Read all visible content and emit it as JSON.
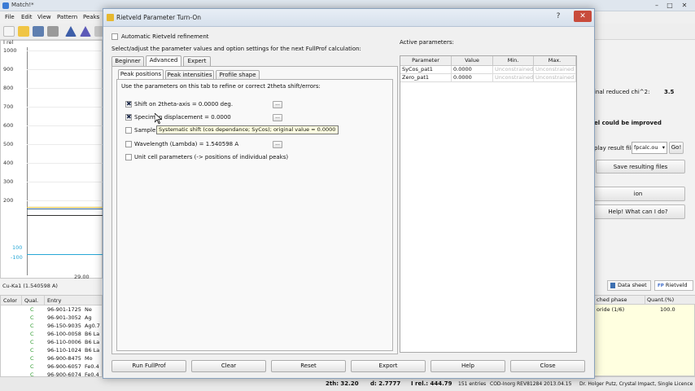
{
  "app": {
    "title": "Match!*",
    "menu": [
      "File",
      "Edit",
      "View",
      "Pattern",
      "Peaks"
    ],
    "plot": {
      "y_axis_label": "I rel",
      "y_ticks": [
        "1000",
        "900",
        "800",
        "700",
        "600",
        "500",
        "400",
        "300",
        "200"
      ],
      "x_tick": "29.00",
      "marker_label_1": "100",
      "marker_label_2": "-100"
    },
    "wavelength_status": "Cu-Ka1 (1.540598 A)",
    "phase_table": {
      "headers": [
        "Color",
        "Qual.",
        "Entry"
      ],
      "rows": [
        {
          "qual": "C",
          "entry": "96-901-1725",
          "name": "Ne"
        },
        {
          "qual": "C",
          "entry": "96-901-3052",
          "name": "Ag"
        },
        {
          "qual": "C",
          "entry": "96-150-9035",
          "name": "Ag0.7"
        },
        {
          "qual": "C",
          "entry": "96-100-0058",
          "name": "B6 La"
        },
        {
          "qual": "C",
          "entry": "96-110-0006",
          "name": "B6 La"
        },
        {
          "qual": "C",
          "entry": "96-110-1024",
          "name": "B6 La"
        },
        {
          "qual": "C",
          "entry": "96-900-8475",
          "name": "Mo"
        },
        {
          "qual": "C",
          "entry": "96-900-6057",
          "name": "Fe0.4"
        },
        {
          "qual": "C",
          "entry": "96-900-6074",
          "name": "Fe0.4"
        }
      ]
    },
    "right_panel": {
      "chi_label": "inal reduced chi^2:",
      "chi_value": "3.5",
      "could_improve": "el could be improved",
      "display_label": "play result file",
      "file_select": "fpcalc.ou",
      "go_button": "Go!",
      "save_button": "Save resulting files",
      "option_button": "ion",
      "help_button": "Help! What can I do?",
      "tabs": [
        "Data sheet",
        "Rietveld"
      ],
      "tab_prefix": "FP",
      "phase_headers": [
        "ched phase",
        "Quant.(%)"
      ],
      "phase_row": {
        "name": "oride (1/6)",
        "quant": "100.0"
      }
    },
    "statusbar": {
      "two_theta": "2th:  32.20",
      "d": "d: 2.7777",
      "irel": "I rel.: 444.79",
      "entries": "151 entries",
      "db": "COD-Inorg REV81284 2013.04.15",
      "credit": "Dr. Holger Putz, Crystal Impact, Single Licence"
    }
  },
  "dialog": {
    "title": "Rietveld Parameter Turn-On",
    "auto_refinement_label": "Automatic Rietveld refinement",
    "instruction": "Select/adjust the parameter values and option settings for the next FullProf calculation:",
    "tabs": [
      "Beginner",
      "Advanced",
      "Expert"
    ],
    "active_tab": "Advanced",
    "subtabs": [
      "Peak positions",
      "Peak intensities",
      "Profile shape"
    ],
    "subtab_description": "Use the parameters on this tab to refine or correct 2theta shift/errors:",
    "params": [
      {
        "label": "Shift on 2theta-axis = 0.0000 deg.",
        "checked": true
      },
      {
        "label": "Specimen displacement = 0.0000",
        "checked": true
      },
      {
        "label": "Sample",
        "checked": false
      },
      {
        "label": "Wavelength (Lambda) = 1.540598 A",
        "checked": false
      },
      {
        "label": "Unit cell parameters (-> positions of individual peaks)",
        "checked": false
      }
    ],
    "dots_label": "...",
    "tooltip": "Systematic shift (cos dependance; SyCos); original value = 0.0000",
    "active_params_title": "Active parameters:",
    "active_params_headers": [
      "Parameter",
      "Value",
      "Min.",
      "Max."
    ],
    "active_params_rows": [
      {
        "parameter": "SyCos_pat1",
        "value": "0.0000",
        "min": "Unconstrained",
        "max": "Unconstrained"
      },
      {
        "parameter": "Zero_pat1",
        "value": "0.0000",
        "min": "Unconstrained",
        "max": "Unconstrained"
      }
    ],
    "buttons": [
      "Run FullProf",
      "Clear",
      "Reset",
      "Export",
      "Help",
      "Close"
    ],
    "window_buttons": {
      "help": "?",
      "close": "✕"
    }
  },
  "colors": {
    "dialog_border": "#8aa2bd",
    "tooltip_bg": "#ffffe1",
    "qual_green": "#2a9a2a",
    "close_red": "#c84b3c",
    "plot_line": "#2b5d8a",
    "marker_cyan": "#27a7d6"
  }
}
